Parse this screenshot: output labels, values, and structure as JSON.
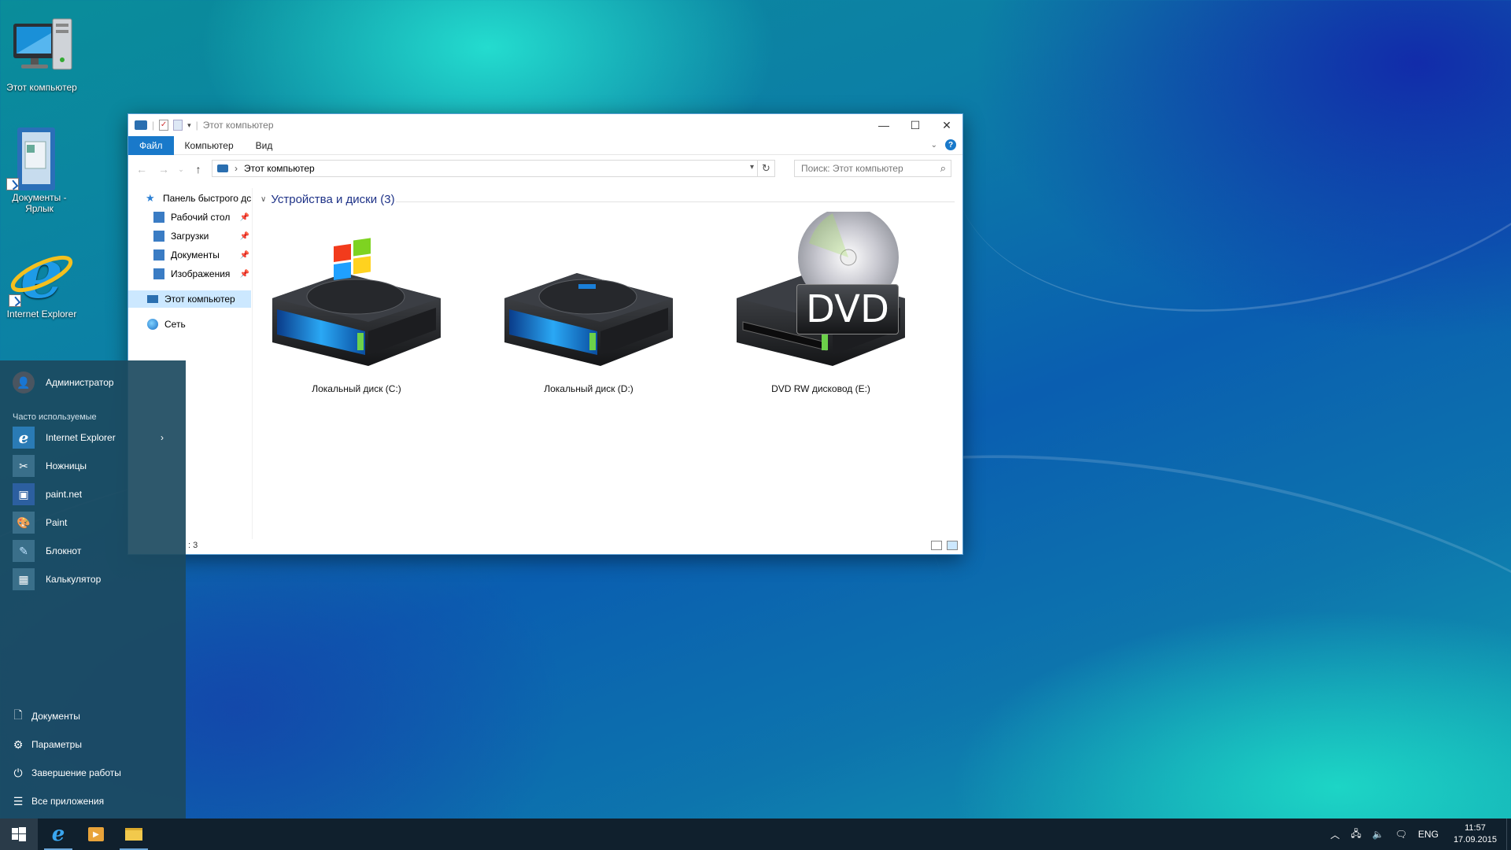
{
  "desktop": {
    "icons": [
      {
        "label": "Этот компьютер"
      },
      {
        "label": "Документы - Ярлык"
      },
      {
        "label": "Internet Explorer"
      }
    ]
  },
  "explorer": {
    "title": "Этот компьютер",
    "ribbon_tabs": [
      "Файл",
      "Компьютер",
      "Вид"
    ],
    "address": "Этот компьютер",
    "search_placeholder": "Поиск: Этот компьютер",
    "nav": {
      "quick_access": "Панель быстрого дс",
      "pinned": [
        "Рабочий стол",
        "Загрузки",
        "Документы",
        "Изображения"
      ],
      "this_pc": "Этот компьютер",
      "network": "Сеть"
    },
    "group_header": "Устройства и диски (3)",
    "drives": [
      {
        "label": "Локальный диск (C:)"
      },
      {
        "label": "Локальный диск (D:)"
      },
      {
        "label": "DVD RW дисковод (E:)",
        "badge": "DVD"
      }
    ],
    "status_count": ": 3"
  },
  "start_menu": {
    "user": "Администратор",
    "section": "Часто используемые",
    "apps": [
      "Internet Explorer",
      "Ножницы",
      "paint.net",
      "Paint",
      "Блокнот",
      "Калькулятор"
    ],
    "bottom": [
      "Документы",
      "Параметры",
      "Завершение работы",
      "Все приложения"
    ]
  },
  "taskbar": {
    "lang": "ENG",
    "time": "11:57",
    "date": "17.09.2015"
  }
}
